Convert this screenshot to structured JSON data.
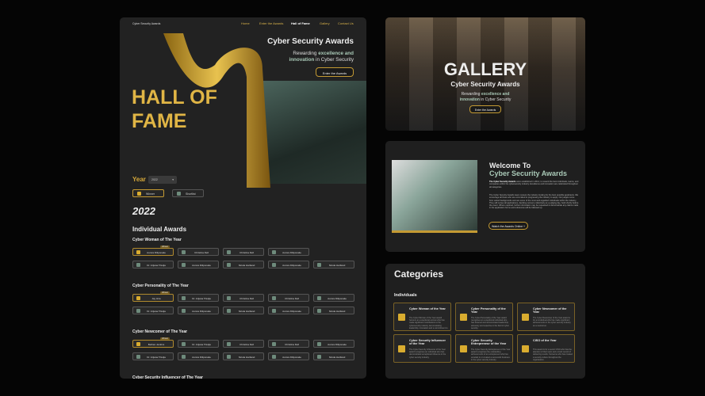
{
  "hall": {
    "brand": "Cyber Security Awards",
    "nav": [
      "Home",
      "Enter the Awards",
      "Hall of Fame",
      "Gallery",
      "Contact Us"
    ],
    "hero_title": "Cyber Security Awards",
    "tag_pre": "Rewarding ",
    "tag_b1": "excellence and",
    "tag_b2": "innovation",
    "tag_post": " in Cyber Security",
    "enter": "Enter the Awards",
    "hof1": "HALL OF",
    "hof2": "FAME",
    "year_label": "Year",
    "year_value": "2022",
    "legend_winner": "Winner",
    "legend_shortlist": "Shortlist",
    "year_heading": "2022",
    "section": "Individual Awards",
    "categories": [
      {
        "name": "Cyber Woman of The Year",
        "rows": [
          [
            "Aurora Diliponaite*",
            "Christina Dell",
            "Christina Dell",
            "Aurora Diliponaite"
          ],
          [
            "Dr. Arijana Trkulja",
            "Aurora Diliponaite",
            "Nicola Hartland",
            "Aurora Diliponaite",
            "Nicola Hartland"
          ]
        ]
      },
      {
        "name": "Cyber Personality of The Year",
        "rows": [
          [
            "Jay Hira*",
            "Dr. Arijana Trkulja",
            "Christina Dell",
            "Christina Dell",
            "Aurora Diliponaite"
          ],
          [
            "Dr. Arijana Trkulja",
            "Aurora Diliponaite",
            "Nicola Hartland",
            "Aurora Diliponaite",
            "Nicola Hartland"
          ]
        ]
      },
      {
        "name": "Cyber Newcomer of The Year",
        "rows": [
          [
            "Bethan Jenkins*",
            "Dr. Arijana Trkulja",
            "Christina Dell",
            "Christina Dell",
            "Aurora Diliponaite"
          ],
          [
            "Dr. Arijana Trkulja",
            "Aurora Diliponaite",
            "Nicola Hartland",
            "Aurora Diliponaite",
            "Nicola Hartland"
          ]
        ]
      },
      {
        "name": "Cyber Security Influencer of The Year",
        "rows": []
      }
    ],
    "winner_tag": "Winner"
  },
  "gallery": {
    "title": "GALLERY",
    "sub": "Cyber Security Awards",
    "tag_pre": "Rewarding ",
    "tag_b1": "excellence and",
    "tag_b2": "innovation",
    "tag_post": " in Cyber Security",
    "enter": "Enter the Awards"
  },
  "welcome": {
    "h1": "Welcome To",
    "h2": "Cyber Security Awards",
    "p1_b": "The Cyber Security Awards",
    "p1": " were established in 2014, to reward the best individuals, teams, and companies within the cybersecurity industry. Excellence and innovation are celebrated throughout all categories.",
    "p2": "The Cyber Security Awards team reviews the industry looking for the best possible applicants. We encourage all those who are committed to progressing the industry to apply. Our judges come from varied backgrounds and are some of the most well-regarded individuals within the industry. They will review all applications, deciding winners collectively as a judging day, held shortly before the event. Where required, further information may be requested to demonstrate any claims made in the application forms and references will be followed up.",
    "cta": "Watch the Awards Online  +"
  },
  "categories": {
    "title": "Categories",
    "group": "Individuals",
    "cards": [
      {
        "t": "Cyber Woman of the Year",
        "d": "The Cyber Woman of the Year award honours an exceptional woman who has made significant contributions to the cybersecurity industry demonstrating leadership, innovation and a commitment to protecting systems and networks."
      },
      {
        "t": "Cyber Personality of the Year",
        "d": "The Cyber Personality of the Year award recognises an exceptional individual who has fostered and demonstrated leadership, advocacy and expertise in the field of cyber security."
      },
      {
        "t": "Cyber Newcomer of the Year",
        "d": "The Cyber Newcomer of the Year award is for an individual who has made significant achievements in the cyber security industry as a newcomer."
      },
      {
        "t": "Cyber Security Influencer of the Year",
        "d": "The Cyber Security Influencer of the Year award recognises an individual who has demonstrated exceptional influence in the cyber security industry."
      },
      {
        "t": "Cyber Security Entrepreneur of the Year",
        "d": "The Cyber Security Entrepreneur of the Year award recognises the outstanding achievements of an entrepreneur who has excelled in or created a successful business in the cyber security industry."
      },
      {
        "t": "CISO of the Year",
        "d": "This award is for a senior CISO who has the attention of their team and a track record of delivering results. Someone who has created a security culture throughout the organisation."
      }
    ]
  }
}
